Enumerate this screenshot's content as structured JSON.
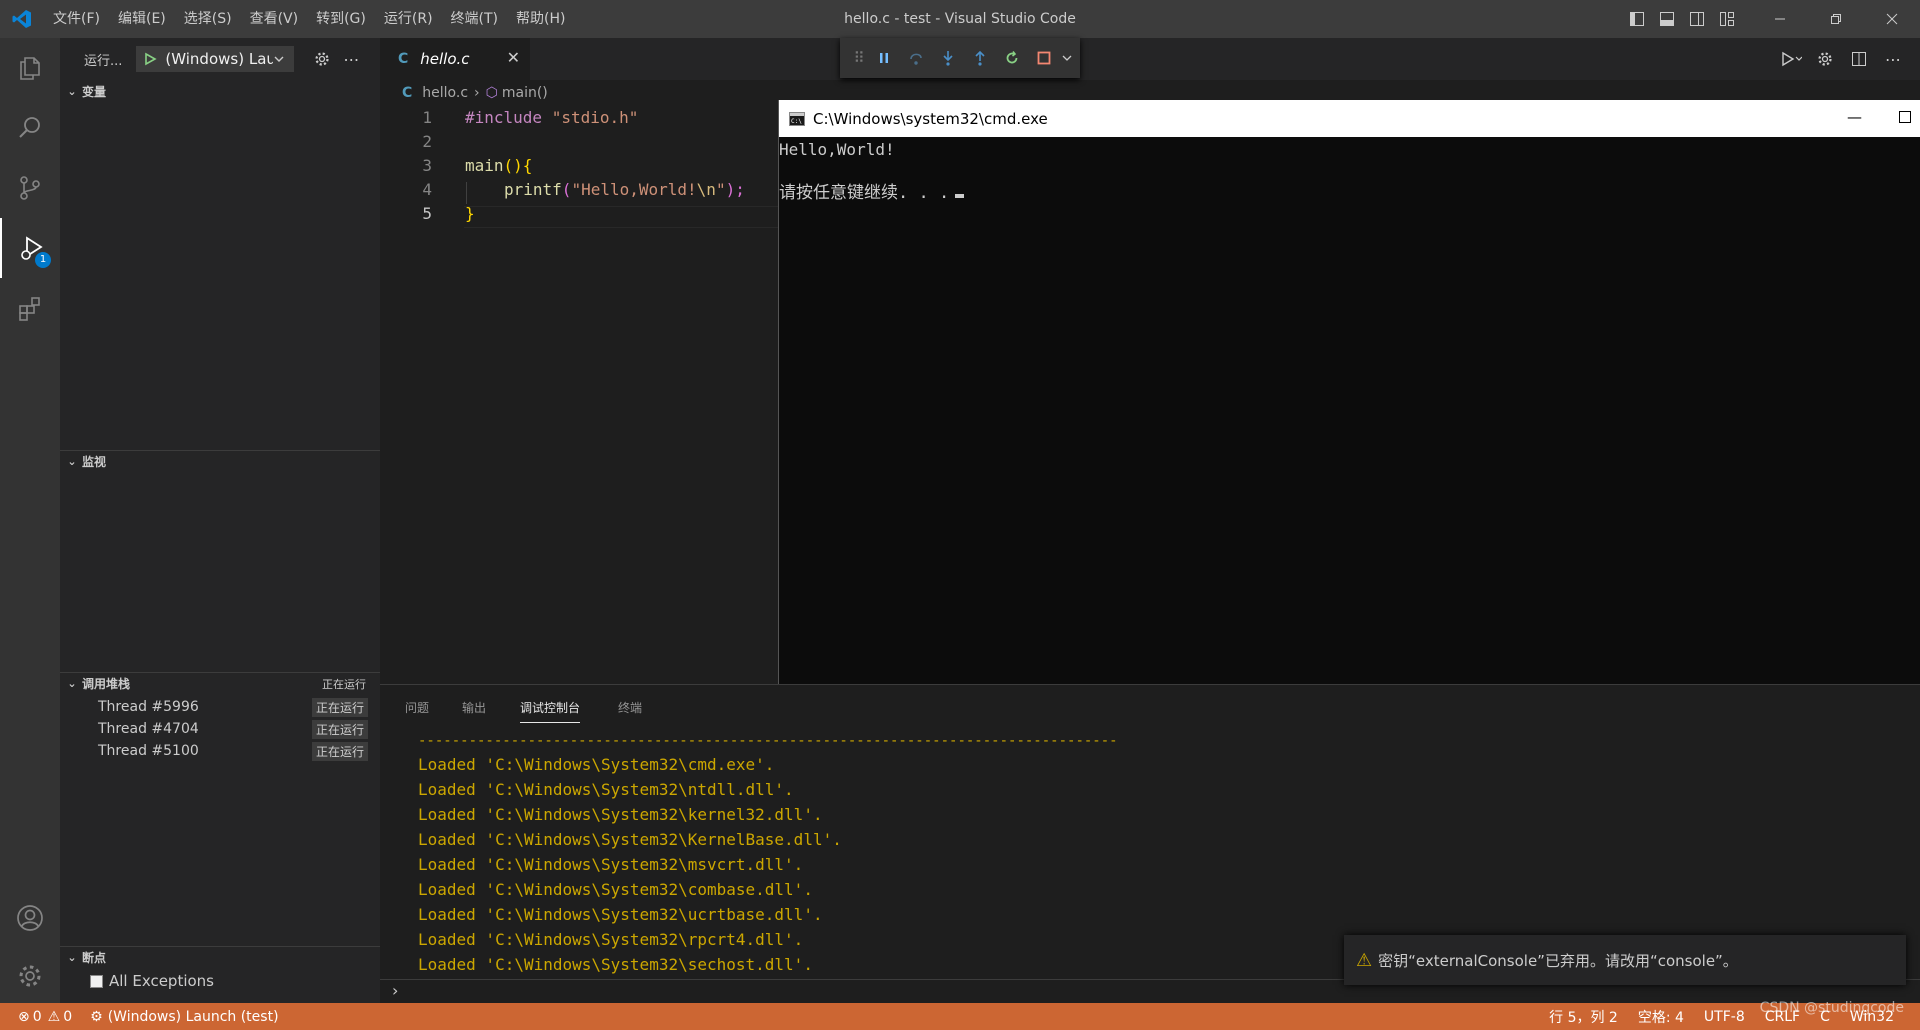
{
  "window": {
    "title": "hello.c - test - Visual Studio Code",
    "menu": [
      "文件(F)",
      "编辑(E)",
      "选择(S)",
      "查看(V)",
      "转到(G)",
      "运行(R)",
      "终端(T)",
      "帮助(H)"
    ]
  },
  "activity": {
    "debug_badge": "1"
  },
  "sidebar": {
    "run_label": "运行...",
    "launch_config": "(Windows) Launch (test)",
    "sections": {
      "variables": "变量",
      "watch": "监视",
      "callstack": "调用堆栈",
      "callstack_status": "正在运行",
      "breakpoints": "断点"
    },
    "threads": [
      {
        "name": "Thread #5996",
        "status": "正在运行"
      },
      {
        "name": "Thread #4704",
        "status": "正在运行"
      },
      {
        "name": "Thread #5100",
        "status": "正在运行"
      }
    ],
    "breakpoint_items": [
      {
        "label": "All Exceptions",
        "checked": false
      }
    ]
  },
  "editor": {
    "tab_name": "hello.c",
    "tab_lang": "C",
    "breadcrumb": {
      "file": "hello.c",
      "symbol": "main()"
    },
    "line_numbers": [
      "1",
      "2",
      "3",
      "4",
      "5"
    ],
    "code": {
      "l1_directive": "#include",
      "l1_header": "\"stdio.h\"",
      "l3_fn": "main",
      "l3_paren": "()",
      "l3_brace": "{",
      "l4_fn": "printf",
      "l4_open": "(",
      "l4_str": "\"Hello,World!",
      "l4_esc": "\\n",
      "l4_strend": "\"",
      "l4_close": ");",
      "l5_brace": "}"
    }
  },
  "cmd": {
    "title": "C:\\Windows\\system32\\cmd.exe",
    "line1": "Hello,World!",
    "line2": "请按任意键继续. . ."
  },
  "panel": {
    "tabs": [
      "问题",
      "输出",
      "调试控制台",
      "终端"
    ],
    "active_tab": "调试控制台",
    "separator": "-----------------------------------------------------------------------------------",
    "loaded": [
      "Loaded 'C:\\Windows\\System32\\cmd.exe'.",
      "Loaded 'C:\\Windows\\System32\\ntdll.dll'.",
      "Loaded 'C:\\Windows\\System32\\kernel32.dll'.",
      "Loaded 'C:\\Windows\\System32\\KernelBase.dll'.",
      "Loaded 'C:\\Windows\\System32\\msvcrt.dll'.",
      "Loaded 'C:\\Windows\\System32\\combase.dll'.",
      "Loaded 'C:\\Windows\\System32\\ucrtbase.dll'.",
      "Loaded 'C:\\Windows\\System32\\rpcrt4.dll'.",
      "Loaded 'C:\\Windows\\System32\\sechost.dll'."
    ],
    "repl_prompt": "›"
  },
  "notification": {
    "text": "密钥“externalConsole”已弃用。请改用“console”。"
  },
  "statusbar": {
    "errors": "0",
    "warnings": "0",
    "debug_target": "(Windows) Launch (test)",
    "position": "行 5，列 2",
    "spaces": "空格: 4",
    "encoding": "UTF-8",
    "eol": "CRLF",
    "language": "C",
    "platform": "Win32"
  },
  "watermark": "CSDN @studingcode",
  "colors": {
    "statusbar": "#cc6633",
    "accent": "#007acc",
    "warning": "#cca700"
  }
}
